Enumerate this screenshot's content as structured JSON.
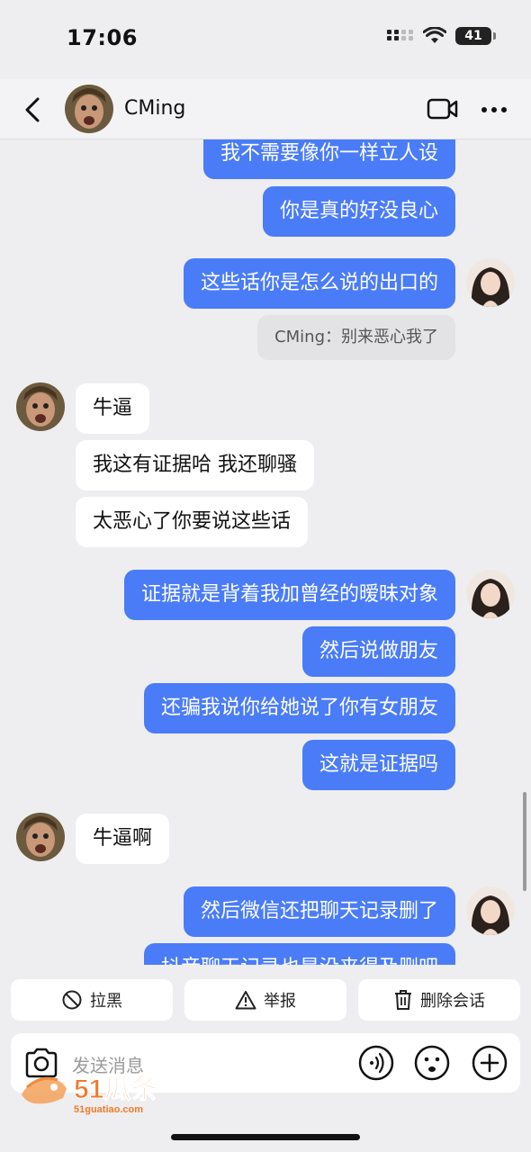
{
  "status_bar": {
    "time": "17:06",
    "battery": "41"
  },
  "header": {
    "contact_name": "CMing"
  },
  "messages": [
    {
      "side": "out",
      "text": "我不需要像你一样立人设"
    },
    {
      "side": "out",
      "text": "你是真的好没良心"
    },
    {
      "side": "out",
      "text": "这些话你是怎么说的出口的"
    },
    {
      "side": "system",
      "text": "CMing：别来恶心我了"
    },
    {
      "side": "in",
      "text": "牛逼"
    },
    {
      "side": "in",
      "text": "我这有证据哈 我还聊骚"
    },
    {
      "side": "in",
      "text": "太恶心了你要说这些话"
    },
    {
      "side": "out",
      "text": "证据就是背着我加曾经的暧昧对象"
    },
    {
      "side": "out",
      "text": "然后说做朋友"
    },
    {
      "side": "out",
      "text": "还骗我说你给她说了你有女朋友"
    },
    {
      "side": "out",
      "text": "这就是证据吗"
    },
    {
      "side": "in",
      "text": "牛逼啊"
    },
    {
      "side": "out",
      "text": "然后微信还把聊天记录删了"
    },
    {
      "side": "out",
      "text": "抖音聊天记录也是没来得及删吧"
    }
  ],
  "actions": {
    "block": "拉黑",
    "report": "举报",
    "delete": "删除会话"
  },
  "input": {
    "placeholder": "发送消息"
  },
  "watermark": {
    "logo": "51瓜条",
    "url": "51guatiao.com"
  },
  "colors": {
    "outgoing_bubble": "#4a7cf7",
    "incoming_bubble": "#ffffff",
    "background": "#eeeef0"
  }
}
